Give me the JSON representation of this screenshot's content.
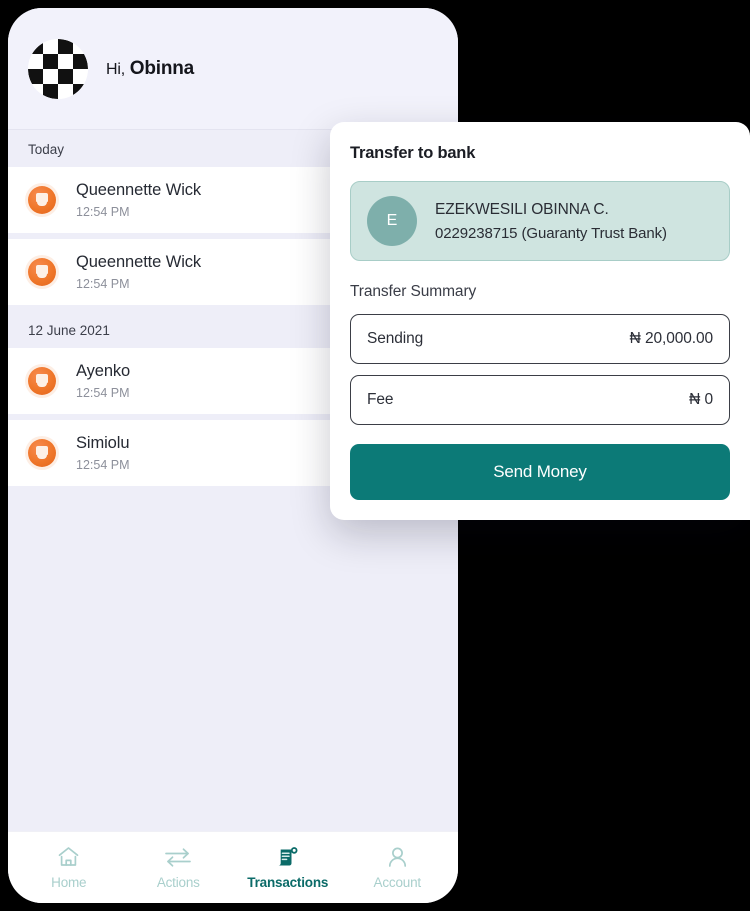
{
  "phone": {
    "header": {
      "avatar_icon": "checkerboard-avatar",
      "greeting_prefix": "Hi,",
      "user_name": "Obinna"
    },
    "transactions": {
      "groups": [
        {
          "date_label": "Today",
          "items": [
            {
              "name": "Queennette Wick",
              "time": "12:54 PM",
              "icon": "orange-person-icon"
            },
            {
              "name": "Queennette Wick",
              "time": "12:54 PM",
              "icon": "orange-person-icon"
            }
          ]
        },
        {
          "date_label": "12 June 2021",
          "items": [
            {
              "name": "Ayenko",
              "time": "12:54 PM",
              "icon": "orange-person-icon"
            },
            {
              "name": "Simiolu",
              "time": "12:54 PM",
              "icon": "orange-person-icon"
            }
          ]
        }
      ]
    },
    "bottom_nav": {
      "items": [
        {
          "label": "Home",
          "icon": "home-icon",
          "active": false
        },
        {
          "label": "Actions",
          "icon": "transfer-arrows-icon",
          "active": false
        },
        {
          "label": "Transactions",
          "icon": "receipt-icon",
          "active": true,
          "badge": true
        },
        {
          "label": "Account",
          "icon": "person-icon",
          "active": false
        }
      ],
      "active_color": "#0b6b68",
      "inactive_color": "#a9cfcc"
    }
  },
  "transfer_card": {
    "title": "Transfer to bank",
    "recipient": {
      "initial": "E",
      "name": "EZEKWESILI OBINNA C.",
      "account_line": "0229238715 (Guaranty Trust Bank)"
    },
    "summary_title": "Transfer Summary",
    "summary_rows": [
      {
        "label": "Sending",
        "value": "₦ 20,000.00"
      },
      {
        "label": "Fee",
        "value": "₦ 0"
      }
    ],
    "send_button_label": "Send Money",
    "accent_color": "#0c7a77"
  }
}
